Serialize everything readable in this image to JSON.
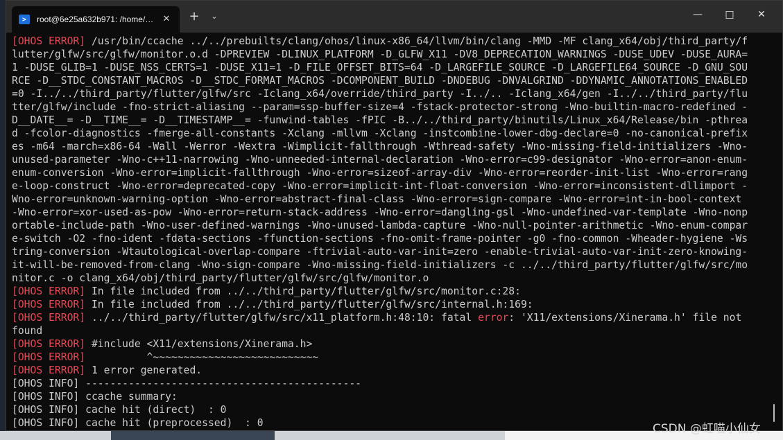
{
  "window": {
    "tab_title": "root@6e25a632b971: /home/…",
    "tab_icon": "powershell-terminal-icon",
    "new_tab_label": "+",
    "dropdown_label": "⌵",
    "minimize_label": "—",
    "maximize_label": "□",
    "close_label": "✕"
  },
  "terminal": {
    "colors": {
      "error": "#e74856",
      "text": "#cccccc",
      "background": "#0c0c0c"
    },
    "lines": [
      {
        "prefix": "[OHOS ERROR]",
        "text": " /usr/bin/ccache ../../prebuilts/clang/ohos/linux-x86_64/llvm/bin/clang -MMD -MF clang_x64/obj/third_party/f"
      },
      {
        "prefix": "",
        "text": "lutter/glfw/src/glfw/monitor.o.d -DPREVIEW -DLINUX_PLATFORM -D_GLFW_X11 -DV8_DEPRECATION_WARNINGS -DUSE_UDEV -DUSE_AURA="
      },
      {
        "prefix": "",
        "text": "1 -DUSE_GLIB=1 -DUSE_NSS_CERTS=1 -DUSE_X11=1 -D_FILE_OFFSET_BITS=64 -D_LARGEFILE_SOURCE -D_LARGEFILE64_SOURCE -D_GNU_SOU"
      },
      {
        "prefix": "",
        "text": "RCE -D__STDC_CONSTANT_MACROS -D__STDC_FORMAT_MACROS -DCOMPONENT_BUILD -DNDEBUG -DNVALGRIND -DDYNAMIC_ANNOTATIONS_ENABLED"
      },
      {
        "prefix": "",
        "text": "=0 -I../../third_party/flutter/glfw/src -Iclang_x64/override/third_party -I../.. -Iclang_x64/gen -I../../third_party/flu"
      },
      {
        "prefix": "",
        "text": "tter/glfw/include -fno-strict-aliasing --param=ssp-buffer-size=4 -fstack-protector-strong -Wno-builtin-macro-redefined -"
      },
      {
        "prefix": "",
        "text": "D__DATE__= -D__TIME__= -D__TIMESTAMP__= -funwind-tables -fPIC -B../../third_party/binutils/Linux_x64/Release/bin -pthrea"
      },
      {
        "prefix": "",
        "text": "d -fcolor-diagnostics -fmerge-all-constants -Xclang -mllvm -Xclang -instcombine-lower-dbg-declare=0 -no-canonical-prefix"
      },
      {
        "prefix": "",
        "text": "es -m64 -march=x86-64 -Wall -Werror -Wextra -Wimplicit-fallthrough -Wthread-safety -Wno-missing-field-initializers -Wno-"
      },
      {
        "prefix": "",
        "text": "unused-parameter -Wno-c++11-narrowing -Wno-unneeded-internal-declaration -Wno-error=c99-designator -Wno-error=anon-enum-"
      },
      {
        "prefix": "",
        "text": "enum-conversion -Wno-error=implicit-fallthrough -Wno-error=sizeof-array-div -Wno-error=reorder-init-list -Wno-error=rang"
      },
      {
        "prefix": "",
        "text": "e-loop-construct -Wno-error=deprecated-copy -Wno-error=implicit-int-float-conversion -Wno-error=inconsistent-dllimport -"
      },
      {
        "prefix": "",
        "text": "Wno-error=unknown-warning-option -Wno-error=abstract-final-class -Wno-error=sign-compare -Wno-error=int-in-bool-context"
      },
      {
        "prefix": "",
        "text": "-Wno-error=xor-used-as-pow -Wno-error=return-stack-address -Wno-error=dangling-gsl -Wno-undefined-var-template -Wno-nonp"
      },
      {
        "prefix": "",
        "text": "ortable-include-path -Wno-user-defined-warnings -Wno-unused-lambda-capture -Wno-null-pointer-arithmetic -Wno-enum-compar"
      },
      {
        "prefix": "",
        "text": "e-switch -O2 -fno-ident -fdata-sections -ffunction-sections -fno-omit-frame-pointer -g0 -fno-common -Wheader-hygiene -Ws"
      },
      {
        "prefix": "",
        "text": "tring-conversion -Wtautological-overlap-compare -ftrivial-auto-var-init=zero -enable-trivial-auto-var-init-zero-knowing-"
      },
      {
        "prefix": "",
        "text": "it-will-be-removed-from-clang -Wno-sign-compare -Wno-missing-field-initializers -c ../../third_party/flutter/glfw/src/mo"
      },
      {
        "prefix": "",
        "text": "nitor.c -o clang_x64/obj/third_party/flutter/glfw/src/glfw/monitor.o"
      },
      {
        "prefix": "[OHOS ERROR]",
        "text": " In file included from ../../third_party/flutter/glfw/src/monitor.c:28:"
      },
      {
        "prefix": "[OHOS ERROR]",
        "text": " In file included from ../../third_party/flutter/glfw/src/internal.h:169:"
      },
      {
        "prefix": "[OHOS ERROR]",
        "text": " ../../third_party/flutter/glfw/src/x11_platform.h:48:10: fatal ",
        "error_word": "error",
        "tail": ": 'X11/extensions/Xinerama.h' file not"
      },
      {
        "prefix": "",
        "text": "found"
      },
      {
        "prefix": "[OHOS ERROR]",
        "text": " #include <X11/extensions/Xinerama.h>"
      },
      {
        "prefix": "[OHOS ERROR]",
        "text": "          ^~~~~~~~~~~~~~~~~~~~~~~~~~~~"
      },
      {
        "prefix": "[OHOS ERROR]",
        "text": " 1 error generated."
      },
      {
        "prefix": "",
        "text": "[OHOS INFO] ---------------------------------------------"
      },
      {
        "prefix": "",
        "text": "[OHOS INFO] ccache summary:"
      },
      {
        "prefix": "",
        "text": "[OHOS INFO] cache hit (direct)  : 0"
      },
      {
        "prefix": "",
        "text": "[OHOS INFO] cache hit (preprocessed)  : 0"
      }
    ]
  },
  "watermark": "CSDN @虹喵小仙女"
}
